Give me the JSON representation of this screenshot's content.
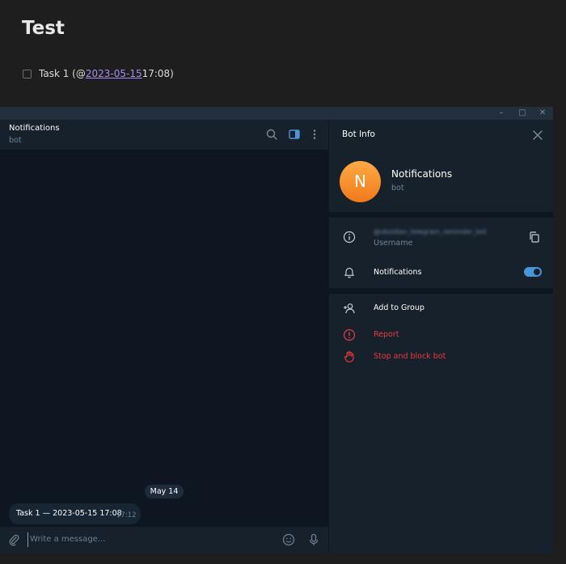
{
  "note": {
    "title": "Test",
    "task": {
      "prefix": "Task 1 (@",
      "date_link": "2023-05-15",
      "suffix": " 17:08)"
    }
  },
  "chat": {
    "title": "Notifications",
    "subtitle": "bot",
    "date_pill": "May 14",
    "message": {
      "text": "Task 1  — 2023-05-15 17:08",
      "time": "17:12"
    },
    "composer": {
      "placeholder": "Write a message..."
    }
  },
  "info": {
    "header": "Bot Info",
    "avatar_letter": "N",
    "name": "Notifications",
    "sub": "bot",
    "username_value": "@obsidian_telegram_reminder_bot",
    "username_label": "Username",
    "notifications_label": "Notifications",
    "add_to_group": "Add to Group",
    "report": "Report",
    "stop_block": "Stop and block bot"
  },
  "colors": {
    "accent": "#4d93d9",
    "danger": "#ec3942",
    "avatar": "#f58c2a",
    "link": "#a88bf4"
  },
  "icons": [
    "search-icon",
    "sidebar-toggle-icon",
    "more-vertical-icon",
    "close-icon",
    "info-icon",
    "copy-icon",
    "bell-icon",
    "add-user-icon",
    "alert-icon",
    "hand-stop-icon",
    "attach-icon",
    "emoji-icon",
    "mic-icon",
    "minimize-icon",
    "maximize-icon",
    "window-close-icon"
  ]
}
